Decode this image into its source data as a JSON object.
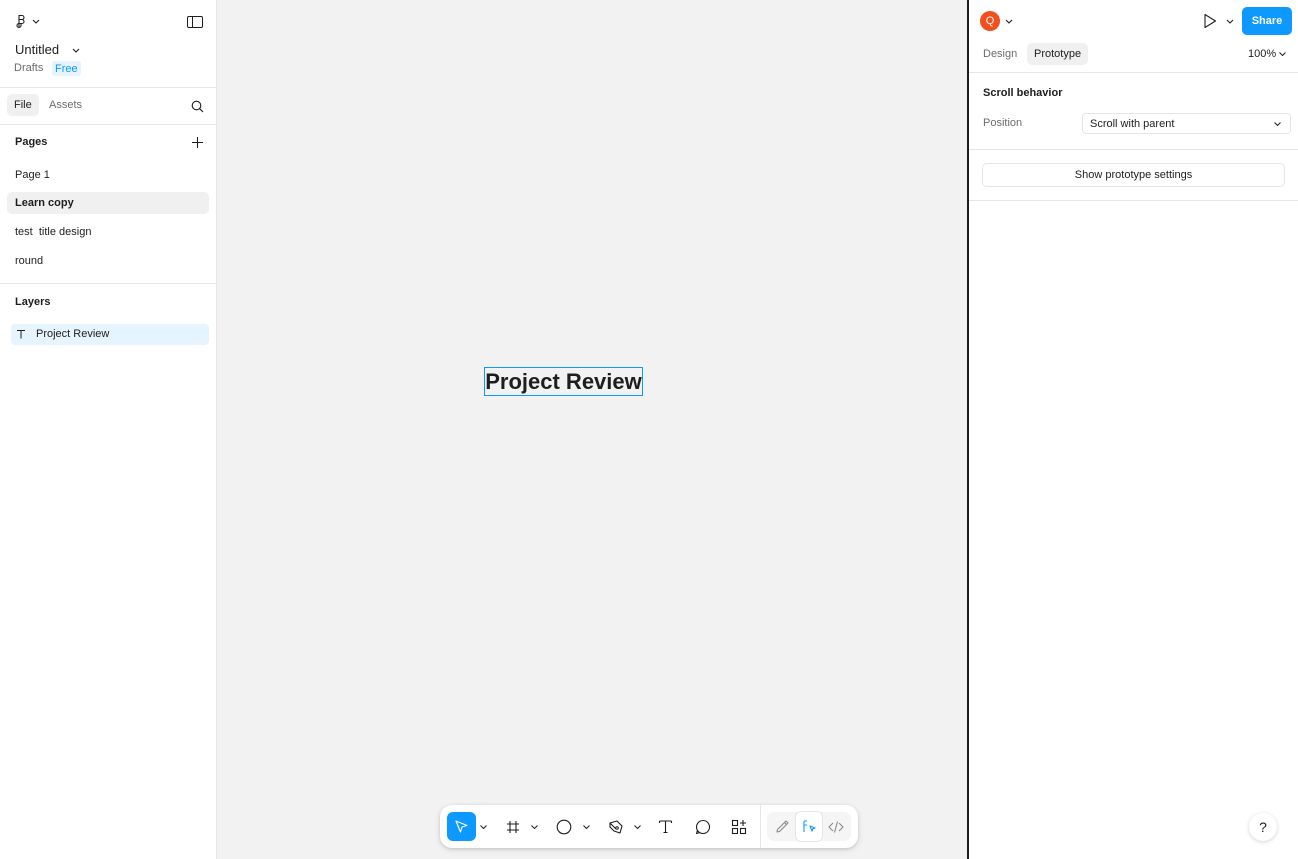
{
  "file": {
    "name": "Untitled",
    "location": "Drafts",
    "plan": "Free"
  },
  "left_tabs": [
    "File",
    "Assets"
  ],
  "pages": {
    "heading": "Pages",
    "items": [
      "Page 1",
      "Learn copy",
      "test  title design",
      "round"
    ],
    "active_index": 1
  },
  "layers": {
    "heading": "Layers",
    "items": [
      {
        "name": "Project Review",
        "type": "text",
        "selected": true
      }
    ]
  },
  "canvas": {
    "text": "Project Review"
  },
  "right": {
    "avatar_letter": "Q",
    "avatar_color": "#f24e1e",
    "share_label": "Share",
    "share_color": "#0d99ff",
    "tabs": [
      "Design",
      "Prototype"
    ],
    "active_tab": "Prototype",
    "zoom": "100%",
    "scroll": {
      "heading": "Scroll behavior",
      "position_label": "Position",
      "position_value": "Scroll with parent"
    },
    "show_settings_label": "Show prototype settings"
  },
  "help_label": "?",
  "toolbar": {
    "tools": [
      "move-tool",
      "frame-tool",
      "shape-tool",
      "pen-tool",
      "text-tool",
      "comment-tool",
      "actions-tool"
    ],
    "modes": [
      "draw-mode",
      "design-mode",
      "dev-mode"
    ],
    "active_tool": "move-tool",
    "active_mode": "design-mode"
  },
  "colors": {
    "accent": "#0d99ff",
    "selection_bg": "#e5f4ff"
  }
}
